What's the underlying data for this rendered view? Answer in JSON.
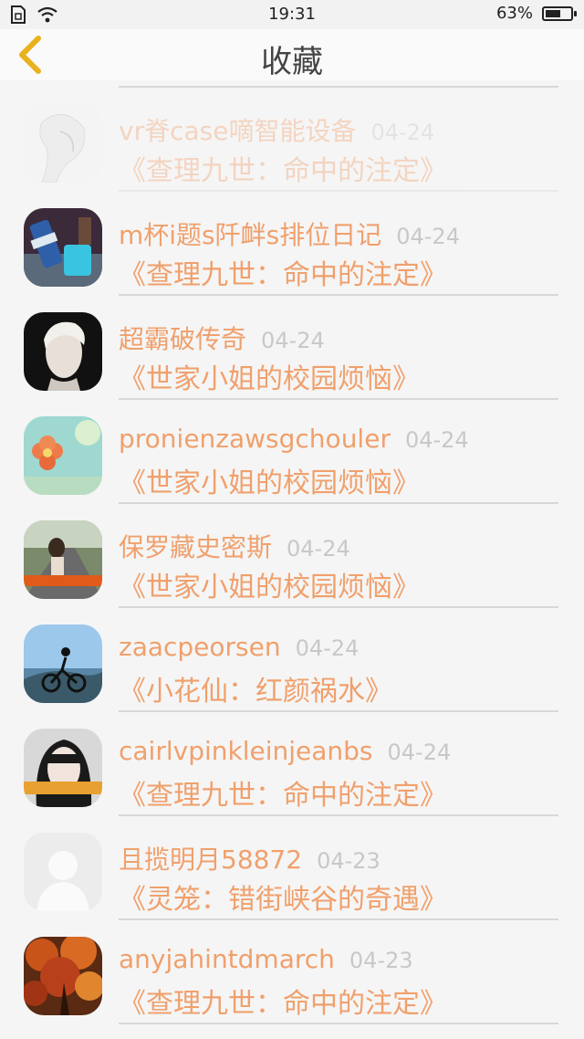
{
  "status": {
    "time": "19:31",
    "battery": "63%",
    "battery_level": 0.63
  },
  "header": {
    "title": "收藏"
  },
  "items": [
    {
      "name": "vr脊case嘀智能设备",
      "date": "04-24",
      "book": "《查理九世：命中的注定》",
      "avatar_icon": "sketch-portrait-avatar"
    },
    {
      "name": "m杯i题s阡衅s排位日记",
      "date": "04-24",
      "book": "《查理九世：命中的注定》",
      "avatar_icon": "blue-bottle-avatar"
    },
    {
      "name": "超霸破传奇",
      "date": "04-24",
      "book": "《世家小姐的校园烦恼》",
      "avatar_icon": "blond-portrait-avatar"
    },
    {
      "name": "pronienzawsgchouler",
      "date": "04-24",
      "book": "《世家小姐的校园烦恼》",
      "avatar_icon": "flower-avatar"
    },
    {
      "name": "保罗藏史密斯",
      "date": "04-24",
      "book": "《世家小姐的校园烦恼》",
      "avatar_icon": "road-girl-avatar"
    },
    {
      "name": "zaacpeorsen",
      "date": "04-24",
      "book": "《小花仙：红颜祸水》",
      "avatar_icon": "cyclist-avatar"
    },
    {
      "name": "cairlvpinkleinjeanbs",
      "date": "04-24",
      "book": "《查理九世：命中的注定》",
      "avatar_icon": "girl-portrait-avatar"
    },
    {
      "name": "且揽明月58872",
      "date": "04-23",
      "book": "《灵笼：错街峡谷的奇遇》",
      "avatar_icon": "default-user-avatar"
    },
    {
      "name": "anyjahintdmarch",
      "date": "04-23",
      "book": "《查理九世：命中的注定》",
      "avatar_icon": "autumn-tree-avatar"
    }
  ],
  "colors": {
    "accent": "#f0a06c",
    "date": "#c8c8c8",
    "back_arrow": "#e8b21e"
  }
}
